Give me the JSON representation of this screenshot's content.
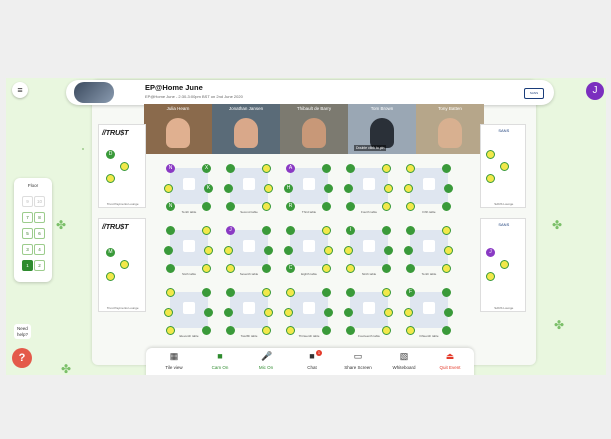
{
  "event": {
    "title": "EP@Home June",
    "subtitle": "EP@Home June - 2:30-3:00pm BST on 2nd June 2020",
    "brand": "SANS",
    "avatar_letter": "J"
  },
  "videos": [
    {
      "name": "Julia Hearn",
      "bg": "#8a6a4c",
      "face": "#e0b090"
    },
    {
      "name": "Jonathan Jansen",
      "bg": "#5a6b78",
      "face": "#d9a88a"
    },
    {
      "name": "Thibault de Barry",
      "bg": "#7c7a70",
      "face": "#c89878"
    },
    {
      "name": "Tom Brown",
      "bg": "#9aa7b4",
      "face": "#2a3038",
      "hint": "Double click to pin"
    },
    {
      "name": "Tony Batten",
      "bg": "#b6a68a",
      "face": "#d8b090"
    }
  ],
  "floor": {
    "title": "Floor",
    "buttons": [
      "9",
      "10",
      "7",
      "8",
      "5",
      "6",
      "3",
      "4",
      "1",
      "2"
    ],
    "active": "1"
  },
  "help": {
    "text_line1": "Need",
    "text_line2": "help?",
    "icon": "?"
  },
  "sponsors": {
    "top_logo": "//TRU$T",
    "top_label": "Trust Payments Lounge",
    "bottom_logo": "//TRU$T",
    "bottom_label": "Trust Payments Lounge",
    "right_top_logo": "SANS",
    "right_top_label": "SANS Lounge",
    "right_bottom_logo": "SANS",
    "right_bottom_label": "SANS Lounge",
    "tagline": "PAYMENTS"
  },
  "tables": [
    {
      "label": "Tenth table",
      "letters": [
        "N",
        "X",
        "",
        "K",
        "N",
        ""
      ]
    },
    {
      "label": "Second table",
      "letters": [
        "",
        "",
        "",
        "",
        "",
        ""
      ]
    },
    {
      "label": "Third table",
      "letters": [
        "A",
        "",
        "H",
        "",
        "R",
        ""
      ]
    },
    {
      "label": "Fourth table",
      "letters": [
        "",
        "",
        "",
        "",
        "",
        ""
      ]
    },
    {
      "label": "Fifth table",
      "letters": [
        "",
        "",
        "",
        "",
        "",
        ""
      ]
    },
    {
      "label": "Sixth table",
      "letters": [
        "",
        "",
        "",
        "",
        "",
        ""
      ]
    },
    {
      "label": "Seventh table",
      "letters": [
        "J",
        "",
        "",
        "",
        "",
        ""
      ]
    },
    {
      "label": "Eighth table",
      "letters": [
        "",
        "",
        "",
        "",
        "C",
        ""
      ]
    },
    {
      "label": "Ninth table",
      "letters": [
        "I",
        "",
        "",
        "",
        "",
        ""
      ]
    },
    {
      "label": "Tenth table",
      "letters": [
        "",
        "",
        "",
        "",
        "",
        ""
      ]
    },
    {
      "label": "Eleventh table",
      "letters": [
        "",
        "",
        "",
        "",
        "",
        ""
      ]
    },
    {
      "label": "Twelfth table",
      "letters": [
        "",
        "",
        "",
        "",
        "",
        ""
      ]
    },
    {
      "label": "Thirteenth table",
      "letters": [
        "",
        "",
        "",
        "",
        "",
        ""
      ]
    },
    {
      "label": "Fourteenth table",
      "letters": [
        "",
        "",
        "",
        "",
        "",
        ""
      ]
    },
    {
      "label": "Fifteenth table",
      "letters": [
        "F",
        "",
        "",
        "",
        "",
        ""
      ]
    }
  ],
  "side_tables": {
    "left_top": [
      "D",
      "",
      ""
    ],
    "left_bottom": [
      "M",
      "",
      ""
    ],
    "right_top": [
      "",
      "",
      ""
    ],
    "right_bottom": [
      "J",
      "",
      ""
    ]
  },
  "toolbar": [
    {
      "label": "Tile view",
      "icon": "grid-icon",
      "glyph": "▦",
      "color": "#333"
    },
    {
      "label": "Cam On",
      "icon": "camera-icon",
      "glyph": "■",
      "color": "#2e8b2e"
    },
    {
      "label": "Mic On",
      "icon": "mic-icon",
      "glyph": "🎤",
      "color": "#2e8b2e"
    },
    {
      "label": "Chat",
      "icon": "chat-icon",
      "glyph": "■",
      "color": "#333",
      "badge": "1"
    },
    {
      "label": "Share Screen",
      "icon": "monitor-icon",
      "glyph": "▭",
      "color": "#333"
    },
    {
      "label": "Whiteboard",
      "icon": "whiteboard-icon",
      "glyph": "▧",
      "color": "#333"
    },
    {
      "label": "Quit Event",
      "icon": "exit-icon",
      "glyph": "⏏",
      "color": "#e43a2a"
    }
  ],
  "colors": {
    "accent_green": "#2e8b2e",
    "seat_yellow": "#f2e84a",
    "seat_green": "#3a9a3a",
    "seat_purple": "#8a3ac4",
    "quit_red": "#e43a2a"
  }
}
